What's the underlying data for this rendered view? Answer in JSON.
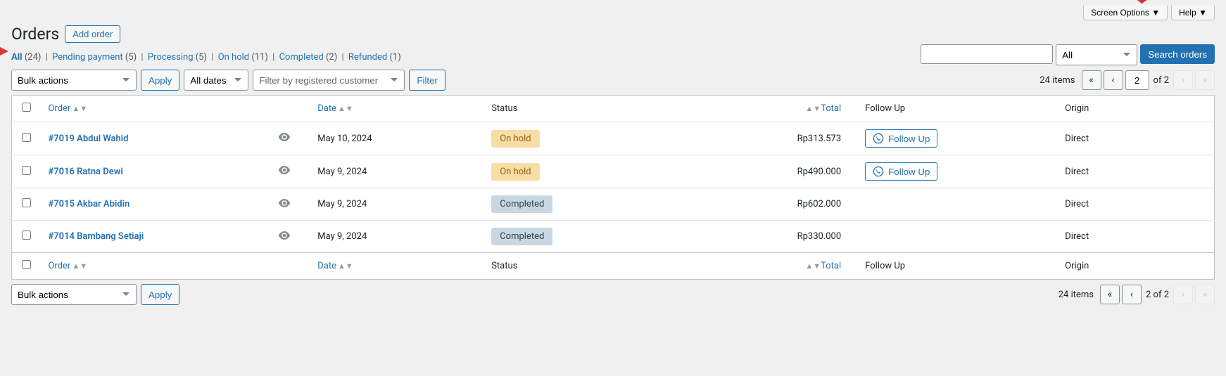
{
  "screen_options": "Screen Options",
  "help": "Help",
  "page_title": "Orders",
  "add_order": "Add order",
  "filters": {
    "all": "All",
    "all_count": "(24)",
    "pending": "Pending payment",
    "pending_count": "(5)",
    "processing": "Processing",
    "processing_count": "(5)",
    "onhold": "On hold",
    "onhold_count": "(11)",
    "completed": "Completed",
    "completed_count": "(2)",
    "refunded": "Refunded",
    "refunded_count": "(1)"
  },
  "search": {
    "reg_type_all": "All",
    "search_orders": "Search orders"
  },
  "tablenav": {
    "bulk_actions": "Bulk actions",
    "apply": "Apply",
    "all_dates": "All dates",
    "filter_customer": "Filter by registered customer",
    "filter": "Filter",
    "items_count": "24 items",
    "page_input": "2",
    "of_total": "of 2",
    "page_display": "2 of 2"
  },
  "columns": {
    "order": "Order",
    "date": "Date",
    "status": "Status",
    "total": "Total",
    "followup": "Follow Up",
    "origin": "Origin"
  },
  "rows": [
    {
      "order": "#7019 Abdul Wahid",
      "date": "May 10, 2024",
      "status_class": "status-onhold",
      "status": "On hold",
      "total": "Rp313.573",
      "followup": "Follow Up",
      "origin": "Direct"
    },
    {
      "order": "#7016 Ratna Dewi",
      "date": "May 9, 2024",
      "status_class": "status-onhold",
      "status": "On hold",
      "total": "Rp490.000",
      "followup": "Follow Up",
      "origin": "Direct"
    },
    {
      "order": "#7015 Akbar Abidin",
      "date": "May 9, 2024",
      "status_class": "status-completed",
      "status": "Completed",
      "total": "Rp602.000",
      "followup": "",
      "origin": "Direct"
    },
    {
      "order": "#7014 Bambang Setiaji",
      "date": "May 9, 2024",
      "status_class": "status-completed",
      "status": "Completed",
      "total": "Rp330.000",
      "followup": "",
      "origin": "Direct"
    }
  ]
}
